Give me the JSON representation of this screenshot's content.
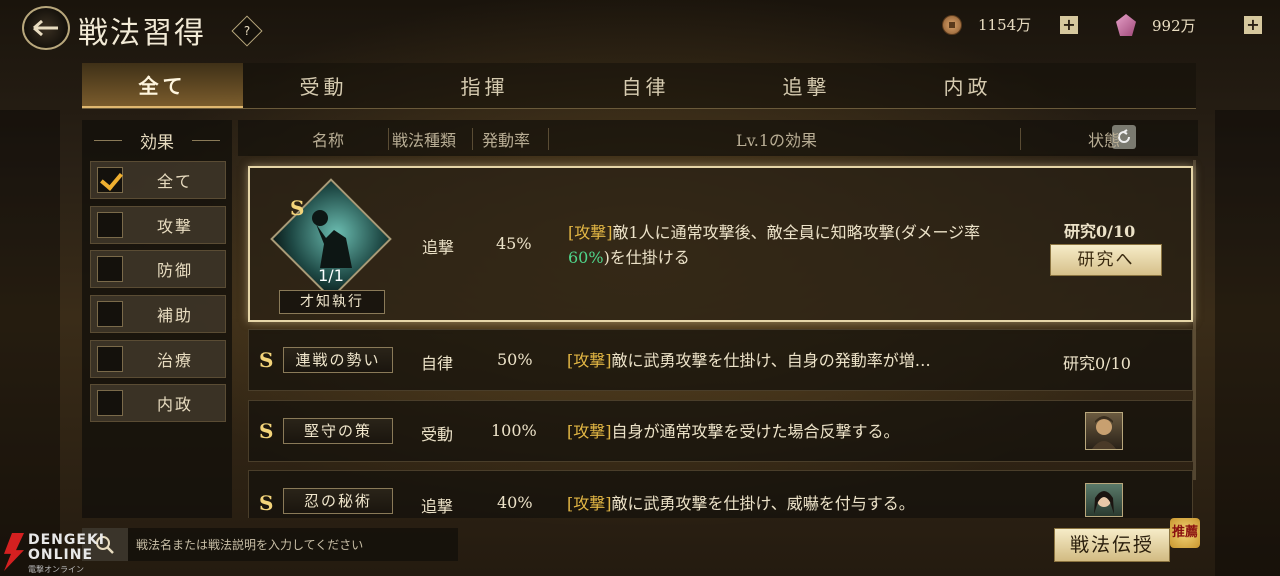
{
  "header": {
    "title": "戦法習得",
    "help": "?",
    "currency_copper": "1154万",
    "currency_gem": "992万"
  },
  "tabs": [
    "全て",
    "受動",
    "指揮",
    "自律",
    "追撃",
    "内政",
    ""
  ],
  "active_tab": "全て",
  "filter": {
    "title": "効果",
    "items": [
      {
        "label": "全て",
        "checked": true
      },
      {
        "label": "攻撃",
        "checked": false
      },
      {
        "label": "防御",
        "checked": false
      },
      {
        "label": "補助",
        "checked": false
      },
      {
        "label": "治療",
        "checked": false
      },
      {
        "label": "内政",
        "checked": false
      }
    ]
  },
  "list_header": {
    "name": "名称",
    "type": "戦法種類",
    "rate": "発動率",
    "effect": "Lv.1の効果",
    "status": "状態"
  },
  "rows": [
    {
      "grade": "S",
      "name": "才知執行",
      "count": "1/1",
      "type": "追撃",
      "rate": "45%",
      "tag": "[攻撃]",
      "desc_before": "敵1人に通常攻撃後、敵全員に知略攻撃(ダメージ率",
      "desc_pct": "60%",
      "desc_after": ")を仕掛ける",
      "status": "研究0/10",
      "button": "研究へ"
    },
    {
      "grade": "S",
      "name": "連戦の勢い",
      "type": "自律",
      "rate": "50%",
      "tag": "[攻撃]",
      "desc": "敵に武勇攻撃を仕掛け、自身の発動率が増…",
      "status": "研究0/10"
    },
    {
      "grade": "S",
      "name": "堅守の策",
      "type": "受動",
      "rate": "100%",
      "tag": "[攻撃]",
      "desc": "自身が通常攻撃を受けた場合反撃する。",
      "status_icon": "general-portrait-icon"
    },
    {
      "grade": "S",
      "name": "忍の秘術",
      "type": "追撃",
      "rate": "40%",
      "tag": "[攻撃]",
      "desc": "敵に武勇攻撃を仕掛け、威嚇を付与する。",
      "status_icon": "female-general-portrait-icon"
    }
  ],
  "search": {
    "placeholder": "戦法名または戦法説明を入力してください"
  },
  "teach_button": "戦法伝授",
  "recommend_badge": "推薦",
  "watermark": {
    "line1": "DENGEKI",
    "line2": "ONLINE",
    "sub": "電撃オンライン"
  },
  "colors": {
    "accent_gold": "#f3d47a",
    "tag_yellow": "#e2b644",
    "pct_green": "#4fd58a"
  }
}
